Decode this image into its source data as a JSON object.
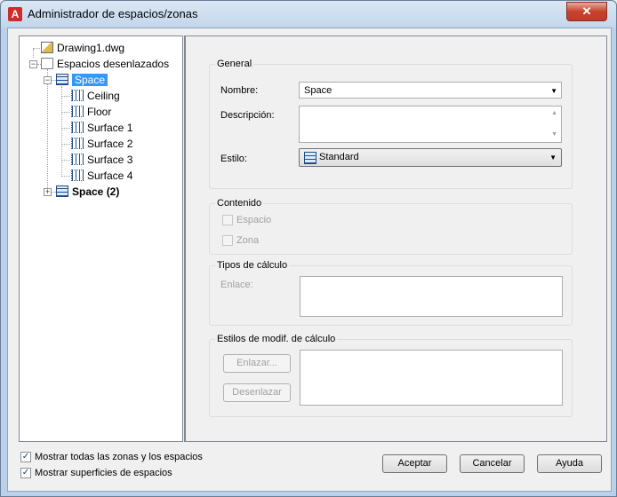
{
  "window": {
    "title": "Administrador de espacios/zonas",
    "close_glyph": "✕"
  },
  "tree": {
    "root": "Drawing1.dwg",
    "folder": "Espacios desenlazados",
    "space_selected": "Space",
    "children": [
      "Ceiling",
      "Floor",
      "Surface 1",
      "Surface 2",
      "Surface 3",
      "Surface 4"
    ],
    "space2": "Space (2)",
    "expander_open": "−",
    "expander_closed": "+"
  },
  "general": {
    "title": "General",
    "nombre_label": "Nombre:",
    "nombre_value": "Space",
    "descripcion_label": "Descripción:",
    "estilo_label": "Estilo:",
    "estilo_value": "Standard"
  },
  "contenido": {
    "title": "Contenido",
    "espacio": "Espacio",
    "zona": "Zona"
  },
  "tipos": {
    "title": "Tipos de cálculo",
    "enlace_label": "Enlace:"
  },
  "estilos": {
    "title": "Estilos de modif. de cálculo",
    "enlazar": "Enlazar...",
    "desenlazar": "Desenlazar"
  },
  "footer": {
    "mostrar_zonas": "Mostrar todas las zonas y los espacios",
    "mostrar_superficies": "Mostrar superficies de espacios",
    "check_glyph": "✓",
    "aceptar": "Aceptar",
    "cancelar": "Cancelar",
    "ayuda": "Ayuda"
  },
  "glyphs": {
    "dropdown": "▼",
    "scroll_up": "▲",
    "scroll_down": "▼"
  },
  "colors": {
    "selection": "#3399ff",
    "close": "#c7432c"
  }
}
